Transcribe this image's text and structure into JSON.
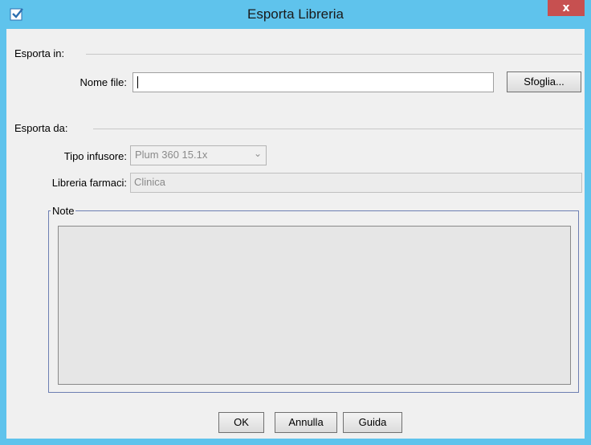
{
  "window": {
    "title": "Esporta Libreria",
    "close_label": "x",
    "app_icon": "document-check-icon",
    "accent_color": "#5fc3ec"
  },
  "export_to": {
    "section_label": "Esporta in:",
    "file_name_label": "Nome file:",
    "file_name_value": "",
    "browse_button": "Sfoglia..."
  },
  "export_from": {
    "section_label": "Esporta da:",
    "infuser_type_label": "Tipo infusore:",
    "infuser_type_value": "Plum 360 15.1x",
    "drug_library_label": "Libreria farmaci:",
    "drug_library_value": "Clinica"
  },
  "notes": {
    "label": "Note",
    "value": ""
  },
  "buttons": {
    "ok": "OK",
    "cancel": "Annulla",
    "help": "Guida"
  }
}
